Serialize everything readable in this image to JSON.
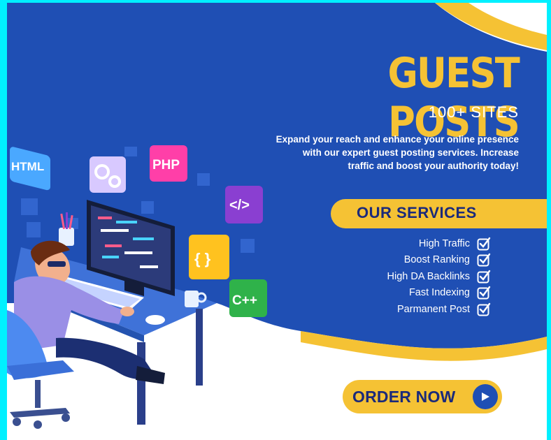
{
  "hero": {
    "title": "GUEST POSTS",
    "subtitle": "100+ SITES",
    "description_lines": [
      "Expand your reach and enhance your online presence",
      "with our expert guest posting services. Increase",
      "traffic and boost your authority today!"
    ]
  },
  "services": {
    "heading": "OUR SERVICES",
    "items": [
      {
        "label": "High Traffic",
        "icon": "checkbox-icon"
      },
      {
        "label": "Boost Ranking",
        "icon": "checkbox-icon"
      },
      {
        "label": "High DA Backlinks",
        "icon": "checkbox-icon"
      },
      {
        "label": "Fast Indexing",
        "icon": "checkbox-icon"
      },
      {
        "label": "Parmanent Post",
        "icon": "checkbox-icon"
      }
    ]
  },
  "cta": {
    "label": "ORDER NOW",
    "icon": "play-arrow-icon"
  },
  "illustration": {
    "tiles": [
      "HTML",
      "PHP",
      "</>",
      "{ }",
      "C++"
    ]
  },
  "colors": {
    "border": "#00f0ff",
    "blue": "#1f4fb4",
    "dark_blue": "#173d96",
    "yellow": "#f5c234",
    "navy_text": "#1b2a7a",
    "white": "#ffffff"
  }
}
